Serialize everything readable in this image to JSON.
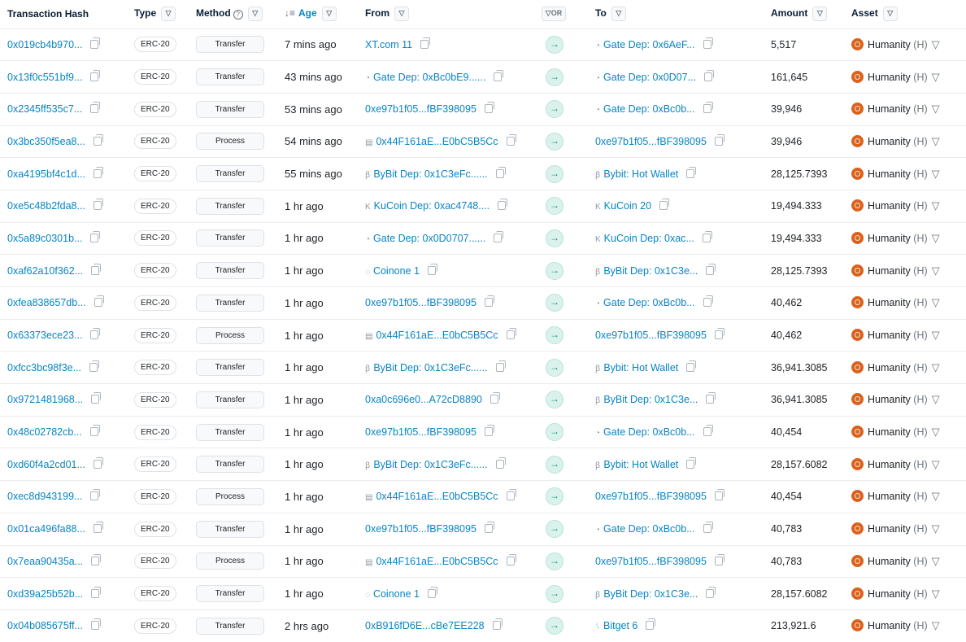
{
  "headers": {
    "hash": "Transaction Hash",
    "type": "Type",
    "method": "Method",
    "age": "Age",
    "from": "From",
    "or": "OR",
    "to": "To",
    "amount": "Amount",
    "asset": "Asset"
  },
  "asset": {
    "name": "Humanity",
    "symbol": "(H)"
  },
  "rows": [
    {
      "hash": "0x019cb4b970...",
      "type": "ERC-20",
      "method": "Transfer",
      "age": "7 mins ago",
      "from": "XT.com 11",
      "from_icon": "",
      "to": "Gate Dep: 0x6AeF...",
      "to_icon": "gate-icon",
      "amount": "5,517"
    },
    {
      "hash": "0x13f0c551bf9...",
      "type": "ERC-20",
      "method": "Transfer",
      "age": "43 mins ago",
      "from": "Gate Dep: 0xBc0bE9......",
      "from_icon": "gate-icon",
      "to": "Gate Dep: 0x0D07...",
      "to_icon": "gate-icon",
      "amount": "161,645"
    },
    {
      "hash": "0x2345ff535c7...",
      "type": "ERC-20",
      "method": "Transfer",
      "age": "53 mins ago",
      "from": "0xe97b1f05...fBF398095",
      "from_icon": "",
      "to": "Gate Dep: 0xBc0b...",
      "to_icon": "gate-icon",
      "amount": "39,946"
    },
    {
      "hash": "0x3bc350f5ea8...",
      "type": "ERC-20",
      "method": "Process",
      "age": "54 mins ago",
      "from": "0x44F161aE...E0bC5B5Cc",
      "from_icon": "contract-icon",
      "to": "0xe97b1f05...fBF398095",
      "to_icon": "",
      "amount": "39,946"
    },
    {
      "hash": "0xa4195bf4c1d...",
      "type": "ERC-20",
      "method": "Transfer",
      "age": "55 mins ago",
      "from": "ByBit Dep: 0x1C3eFc......",
      "from_icon": "bybit-icon",
      "to": "Bybit: Hot Wallet",
      "to_icon": "bybit-icon",
      "amount": "28,125.7393"
    },
    {
      "hash": "0xe5c48b2fda8...",
      "type": "ERC-20",
      "method": "Transfer",
      "age": "1 hr ago",
      "from": "KuCoin Dep: 0xac4748....",
      "from_icon": "kucoin-icon",
      "to": "KuCoin 20",
      "to_icon": "kucoin-icon",
      "amount": "19,494.333"
    },
    {
      "hash": "0x5a89c0301b...",
      "type": "ERC-20",
      "method": "Transfer",
      "age": "1 hr ago",
      "from": "Gate Dep: 0x0D0707......",
      "from_icon": "gate-icon",
      "to": "KuCoin Dep: 0xac...",
      "to_icon": "kucoin-icon",
      "amount": "19,494.333"
    },
    {
      "hash": "0xaf62a10f362...",
      "type": "ERC-20",
      "method": "Transfer",
      "age": "1 hr ago",
      "from": "Coinone 1",
      "from_icon": "coinone-icon",
      "to": "ByBit Dep: 0x1C3e...",
      "to_icon": "bybit-icon",
      "amount": "28,125.7393"
    },
    {
      "hash": "0xfea838657db...",
      "type": "ERC-20",
      "method": "Transfer",
      "age": "1 hr ago",
      "from": "0xe97b1f05...fBF398095",
      "from_icon": "",
      "to": "Gate Dep: 0xBc0b...",
      "to_icon": "gate-icon",
      "amount": "40,462"
    },
    {
      "hash": "0x63373ece23...",
      "type": "ERC-20",
      "method": "Process",
      "age": "1 hr ago",
      "from": "0x44F161aE...E0bC5B5Cc",
      "from_icon": "contract-icon",
      "to": "0xe97b1f05...fBF398095",
      "to_icon": "",
      "amount": "40,462"
    },
    {
      "hash": "0xfcc3bc98f3e...",
      "type": "ERC-20",
      "method": "Transfer",
      "age": "1 hr ago",
      "from": "ByBit Dep: 0x1C3eFc......",
      "from_icon": "bybit-icon",
      "to": "Bybit: Hot Wallet",
      "to_icon": "bybit-icon",
      "amount": "36,941.3085"
    },
    {
      "hash": "0x9721481968...",
      "type": "ERC-20",
      "method": "Transfer",
      "age": "1 hr ago",
      "from": "0xa0c696e0...A72cD8890",
      "from_icon": "",
      "to": "ByBit Dep: 0x1C3e...",
      "to_icon": "bybit-icon",
      "amount": "36,941.3085"
    },
    {
      "hash": "0x48c02782cb...",
      "type": "ERC-20",
      "method": "Transfer",
      "age": "1 hr ago",
      "from": "0xe97b1f05...fBF398095",
      "from_icon": "",
      "to": "Gate Dep: 0xBc0b...",
      "to_icon": "gate-icon",
      "amount": "40,454"
    },
    {
      "hash": "0xd60f4a2cd01...",
      "type": "ERC-20",
      "method": "Transfer",
      "age": "1 hr ago",
      "from": "ByBit Dep: 0x1C3eFc......",
      "from_icon": "bybit-icon",
      "to": "Bybit: Hot Wallet",
      "to_icon": "bybit-icon",
      "amount": "28,157.6082"
    },
    {
      "hash": "0xec8d943199...",
      "type": "ERC-20",
      "method": "Process",
      "age": "1 hr ago",
      "from": "0x44F161aE...E0bC5B5Cc",
      "from_icon": "contract-icon",
      "to": "0xe97b1f05...fBF398095",
      "to_icon": "",
      "amount": "40,454"
    },
    {
      "hash": "0x01ca496fa88...",
      "type": "ERC-20",
      "method": "Transfer",
      "age": "1 hr ago",
      "from": "0xe97b1f05...fBF398095",
      "from_icon": "",
      "to": "Gate Dep: 0xBc0b...",
      "to_icon": "gate-icon",
      "amount": "40,783"
    },
    {
      "hash": "0x7eaa90435a...",
      "type": "ERC-20",
      "method": "Process",
      "age": "1 hr ago",
      "from": "0x44F161aE...E0bC5B5Cc",
      "from_icon": "contract-icon",
      "to": "0xe97b1f05...fBF398095",
      "to_icon": "",
      "amount": "40,783"
    },
    {
      "hash": "0xd39a25b52b...",
      "type": "ERC-20",
      "method": "Transfer",
      "age": "1 hr ago",
      "from": "Coinone 1",
      "from_icon": "coinone-icon",
      "to": "ByBit Dep: 0x1C3e...",
      "to_icon": "bybit-icon",
      "amount": "28,157.6082"
    },
    {
      "hash": "0x04b085675ff...",
      "type": "ERC-20",
      "method": "Transfer",
      "age": "2 hrs ago",
      "from": "0xB916fD6E...cBe7EE228",
      "from_icon": "",
      "to": "Bitget 6",
      "to_icon": "bitget-icon",
      "amount": "213,921.6"
    }
  ],
  "colors": {
    "link": "#0784c3",
    "arrow_bg": "#dbf2ec",
    "arrow_fg": "#00a186",
    "asset_logo": "#d9621f"
  }
}
